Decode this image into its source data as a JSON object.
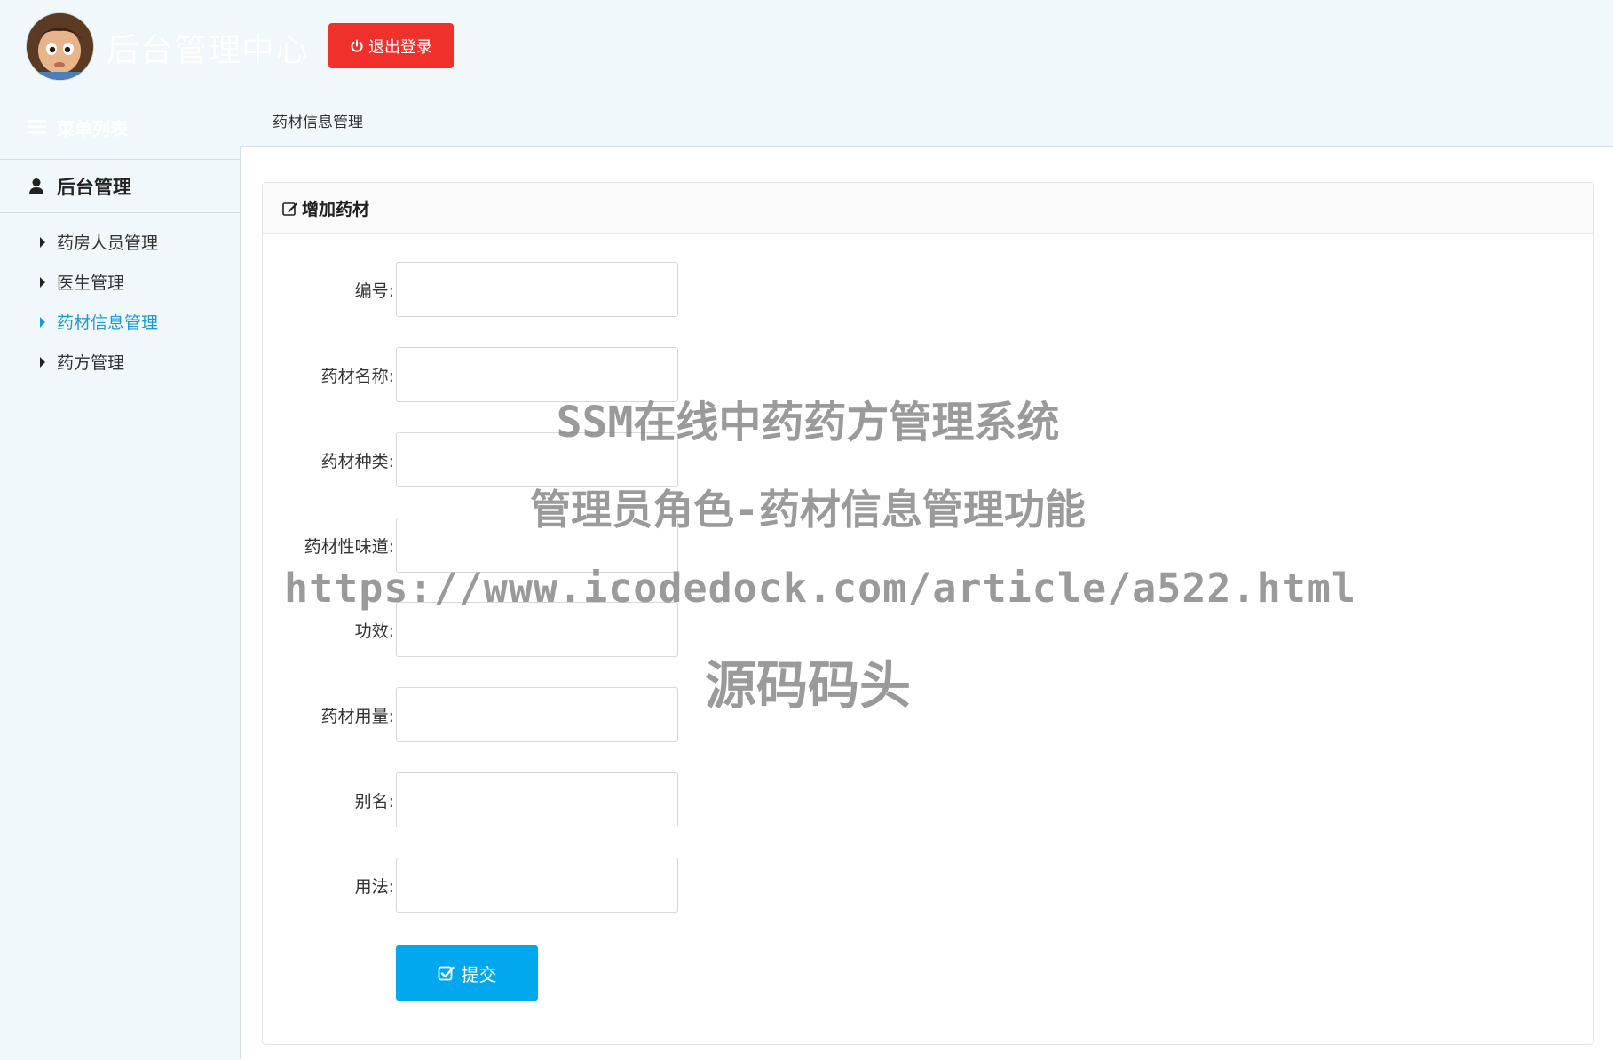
{
  "header": {
    "title": "后台管理中心",
    "logout_label": "退出登录",
    "avatar_icon": "cartoon-avatar"
  },
  "sidebar": {
    "menu_heading": "菜单列表",
    "group_title": "后台管理",
    "items": [
      {
        "label": "药房人员管理",
        "active": false
      },
      {
        "label": "医生管理",
        "active": false
      },
      {
        "label": "药材信息管理",
        "active": true
      },
      {
        "label": "药方管理",
        "active": false
      }
    ]
  },
  "breadcrumb": "药材信息管理",
  "panel": {
    "title": "增加药材",
    "fields": [
      {
        "label": "编号:",
        "value": ""
      },
      {
        "label": "药材名称:",
        "value": ""
      },
      {
        "label": "药材种类:",
        "value": ""
      },
      {
        "label": "药材性味道:",
        "value": ""
      },
      {
        "label": "功效:",
        "value": ""
      },
      {
        "label": "药材用量:",
        "value": ""
      },
      {
        "label": "别名:",
        "value": ""
      },
      {
        "label": "用法:",
        "value": ""
      }
    ],
    "submit_label": "提交"
  },
  "watermark": {
    "line1": "SSM在线中药药方管理系统",
    "line2": "管理员角色-药材信息管理功能",
    "line3": "https://www.icodedock.com/article/a522.html",
    "line4": "源码码头"
  },
  "colors": {
    "background": "#f1f8fb",
    "logout": "#f0302b",
    "submit": "#02a8ee",
    "active_nav": "#1f9bd3"
  }
}
